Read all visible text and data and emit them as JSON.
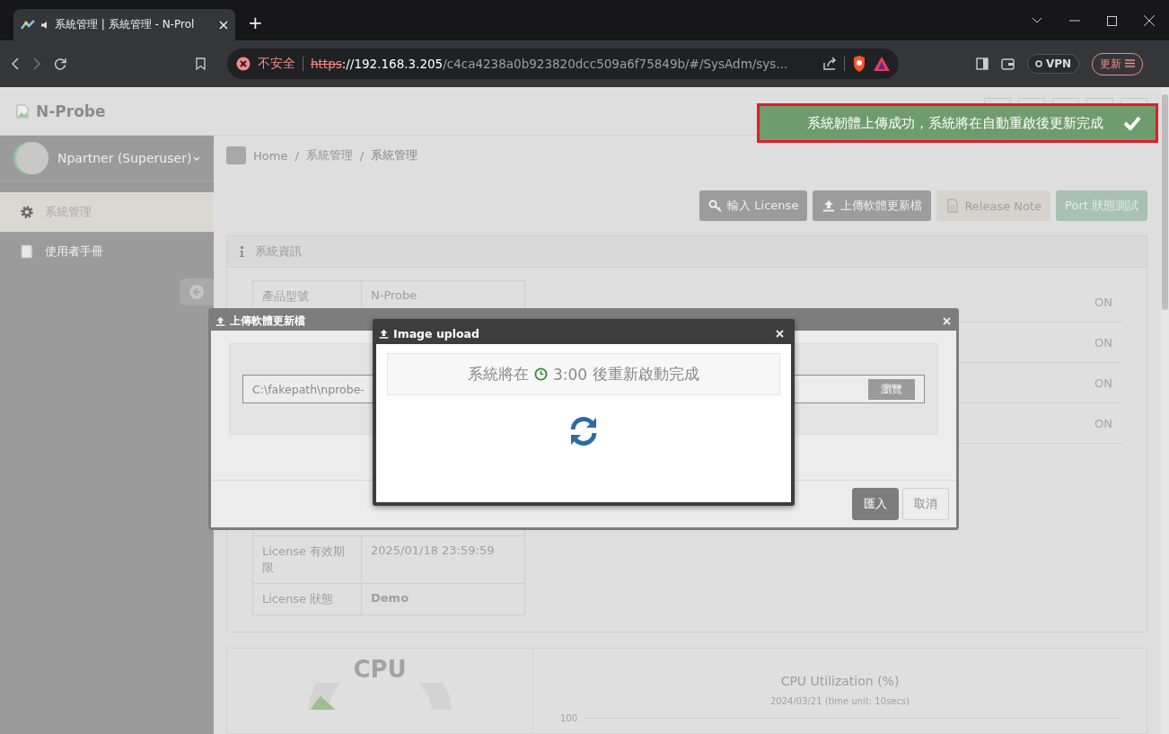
{
  "browser": {
    "tab": {
      "title": "系統管理 | 系統管理 - N-Prol"
    },
    "new_tab": "+",
    "address": {
      "security": "不安全",
      "scheme": "https",
      "host": "://192.168.3.205",
      "path": "/c4ca4238a0b923820dcc509a6f75849b/#/SysAdm/sys..."
    },
    "vpn": "VPN",
    "update": "更新"
  },
  "header": {
    "logo": "N-Probe"
  },
  "sidebar": {
    "user": "Npartner (Superuser)",
    "items": [
      {
        "label": "系統管理",
        "selected": true
      },
      {
        "label": "使用者手冊",
        "selected": false
      }
    ]
  },
  "breadcrumb": {
    "items": [
      "Home",
      "系統管理",
      "系統管理"
    ],
    "separator": "/"
  },
  "toolbar": [
    {
      "label": "輸入 License",
      "disabled": false
    },
    {
      "label": "上傳軟體更新檔",
      "disabled": false
    },
    {
      "label": "Release Note",
      "disabled": true
    },
    {
      "label": "Port 狀態測試",
      "disabled": true
    }
  ],
  "info_panel": {
    "title": "系統資訊",
    "rows": [
      {
        "label": "產品型號",
        "value": "N-Probe"
      },
      {
        "label": "License 有效期限",
        "value": "2025/01/18 23:59:59"
      },
      {
        "label": "License 狀態",
        "value": "Demo"
      }
    ],
    "statuses": [
      "ON",
      "ON",
      "ON",
      "ON"
    ]
  },
  "toast": {
    "message": "系統韌體上傳成功，系統將在自動重啟後更新完成"
  },
  "upload_dialog": {
    "title": "上傳軟體更新檔",
    "file": "C:\\fakepath\\nprobe-",
    "browse": "瀏覽",
    "buttons": [
      {
        "label": "匯入",
        "primary": true
      },
      {
        "label": "取消",
        "primary": false
      }
    ]
  },
  "image_dialog": {
    "title": "Image upload",
    "message_before": "系統將在",
    "time": "3:00",
    "message_after": "後重新啟動完成"
  },
  "cpu": {
    "title": "CPU",
    "chart_title": "CPU Utilization (%)",
    "chart_subtitle": "2024/03/21 (time unit: 10secs)",
    "tick": "100"
  }
}
